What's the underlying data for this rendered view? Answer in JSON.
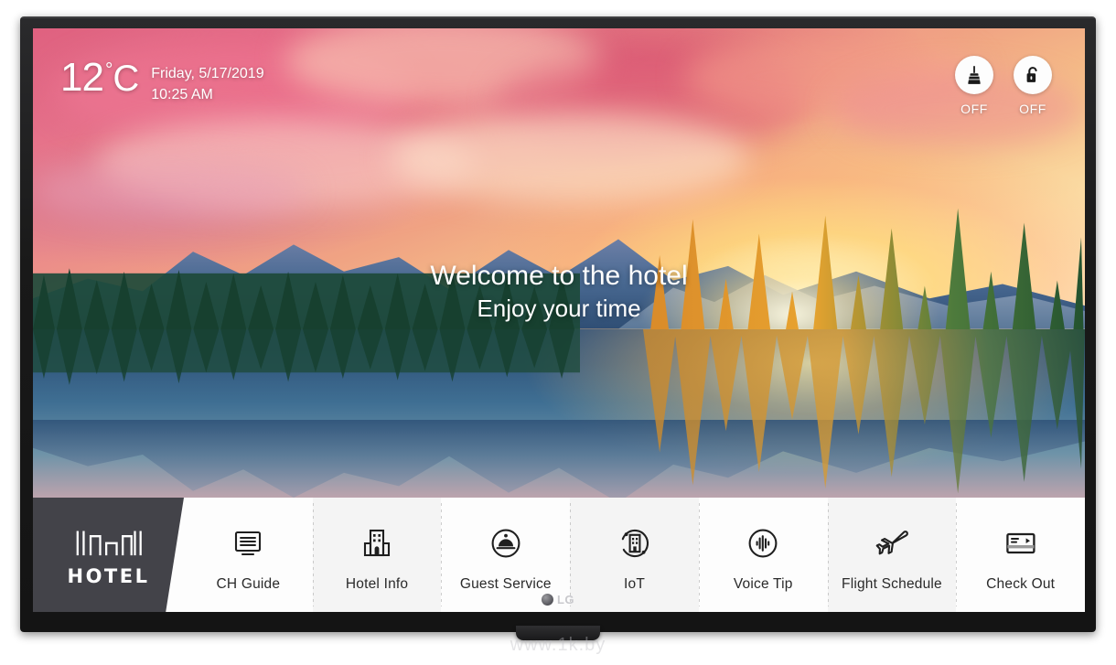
{
  "device": {
    "brand": "LG",
    "watermark": "www.1k.by"
  },
  "screen": {
    "weather": {
      "temperature": "12",
      "degree_symbol": "°",
      "unit": "C",
      "date": "Friday, 5/17/2019",
      "time": "10:25 AM"
    },
    "service_icons": [
      {
        "icon": "broom-icon",
        "name": "make-up-room",
        "state": "OFF"
      },
      {
        "icon": "open-padlock-icon",
        "name": "do-not-disturb",
        "state": "OFF"
      }
    ],
    "welcome": {
      "line1": "Welcome to the hotel",
      "line2": "Enjoy your time"
    },
    "menubar": {
      "brand_tile": {
        "logo": "hotel-building-skyline-icon",
        "label": "HOTEL"
      },
      "items": [
        {
          "label": "CH Guide",
          "icon": "tv-guide-icon"
        },
        {
          "label": "Hotel Info",
          "icon": "building-icon"
        },
        {
          "label": "Guest Service",
          "icon": "service-bell-icon"
        },
        {
          "label": "IoT",
          "icon": "iot-connected-building-icon"
        },
        {
          "label": "Voice Tip",
          "icon": "voice-waveform-icon"
        },
        {
          "label": "Flight Schedule",
          "icon": "airplane-departure-icon"
        },
        {
          "label": "Check Out",
          "icon": "credit-card-icon"
        }
      ]
    }
  },
  "colors": {
    "menubar_background": "#fdfdfd",
    "brand_tile_background": "#434349",
    "text_dark": "#2a2a2a",
    "osd_text": "#ffffff"
  }
}
